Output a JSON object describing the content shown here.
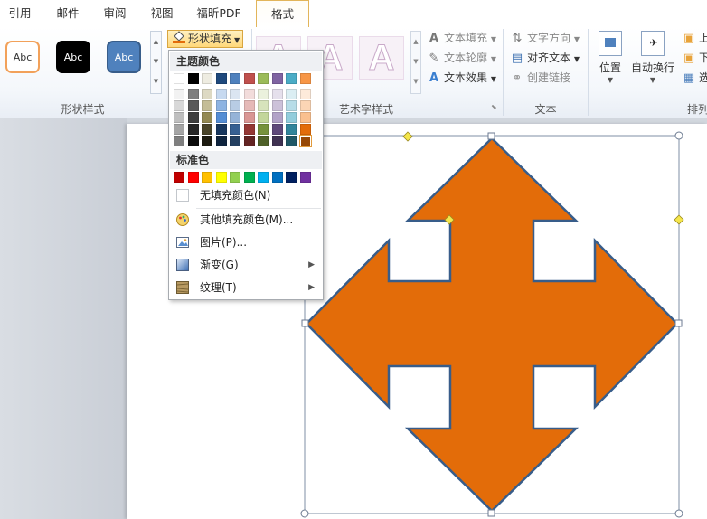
{
  "tabs": [
    {
      "label": "引用"
    },
    {
      "label": "邮件"
    },
    {
      "label": "审阅"
    },
    {
      "label": "视图"
    },
    {
      "label": "福昕PDF"
    },
    {
      "label": "格式"
    }
  ],
  "ribbon": {
    "shape_styles": {
      "label": "形状样式",
      "presets": [
        "Abc",
        "Abc",
        "Abc"
      ],
      "fill_button": "形状填充"
    },
    "wordart": {
      "label": "艺术字样式",
      "thumb_letter": "A",
      "text_fill": "文本填充",
      "text_outline": "文本轮廓",
      "text_effects": "文本效果"
    },
    "text": {
      "label": "文本",
      "direction": "文字方向",
      "align": "对齐文本",
      "link": "创建链接"
    },
    "arrange": {
      "label": "排列",
      "position": "位置",
      "wrap": "自动换行",
      "bring_forward": "上",
      "send_backward": "下",
      "selection": "选"
    }
  },
  "menu": {
    "theme_colors_label": "主题颜色",
    "theme_top_row": [
      "#ffffff",
      "#000000",
      "#eeece1",
      "#1f497d",
      "#4f81bd",
      "#c0504d",
      "#9bbb59",
      "#8064a2",
      "#4bacc6",
      "#f79646"
    ],
    "theme_shades": [
      [
        "#f2f2f2",
        "#7f7f7f",
        "#ddd9c3",
        "#c6d9f0",
        "#dbe5f1",
        "#f2dcdb",
        "#ebf1dd",
        "#e5e0ec",
        "#dbeef3",
        "#fdeada"
      ],
      [
        "#d8d8d8",
        "#595959",
        "#c4bd97",
        "#8db3e2",
        "#b8cce4",
        "#e5b9b7",
        "#d7e3bc",
        "#ccc1d9",
        "#b7dde8",
        "#fbd5b5"
      ],
      [
        "#bfbfbf",
        "#3f3f3f",
        "#938953",
        "#548dd4",
        "#95b3d7",
        "#d99694",
        "#c3d69b",
        "#b2a2c7",
        "#92cddc",
        "#fac08f"
      ],
      [
        "#a5a5a5",
        "#262626",
        "#494429",
        "#17365d",
        "#366092",
        "#953734",
        "#76923c",
        "#5f497a",
        "#31859b",
        "#e36c09"
      ],
      [
        "#7f7f7f",
        "#0c0c0c",
        "#1d1b10",
        "#0f243e",
        "#244061",
        "#632423",
        "#4f6128",
        "#3f3151",
        "#205867",
        "#974806"
      ]
    ],
    "selected_swatch": {
      "shade_row": 4,
      "col": 9
    },
    "standard_colors_label": "标准色",
    "standard_colors": [
      "#c00000",
      "#ff0000",
      "#ffc000",
      "#ffff00",
      "#92d050",
      "#00b050",
      "#00b0f0",
      "#0070c0",
      "#002060",
      "#7030a0"
    ],
    "no_fill": "无填充颜色(N)",
    "more_colors": "其他填充颜色(M)...",
    "picture": "图片(P)...",
    "gradient": "渐变(G)",
    "texture": "纹理(T)"
  },
  "shape": {
    "fill_color": "#e36c09",
    "stroke_color": "#385d8a"
  }
}
